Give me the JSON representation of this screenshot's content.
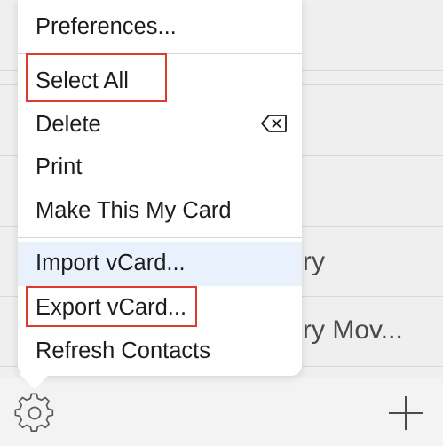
{
  "background_list": {
    "rows": [
      {
        "text": ""
      },
      {
        "text": ""
      },
      {
        "text": ""
      },
      {
        "text": "ry"
      },
      {
        "text": "ry Mov..."
      }
    ]
  },
  "menu": {
    "items": [
      {
        "label": "Preferences..."
      },
      {
        "label": "Select All"
      },
      {
        "label": "Delete"
      },
      {
        "label": "Print"
      },
      {
        "label": "Make This My Card"
      },
      {
        "label": "Import vCard..."
      },
      {
        "label": "Export vCard..."
      },
      {
        "label": "Refresh Contacts"
      }
    ],
    "highlighted_item": "Import vCard..."
  },
  "toolbar": {
    "settings_icon": "gear-icon",
    "add_icon": "plus-icon"
  },
  "colors": {
    "highlight_annotation": "#e03a2f",
    "menu_hover": "#e9f2fc"
  }
}
